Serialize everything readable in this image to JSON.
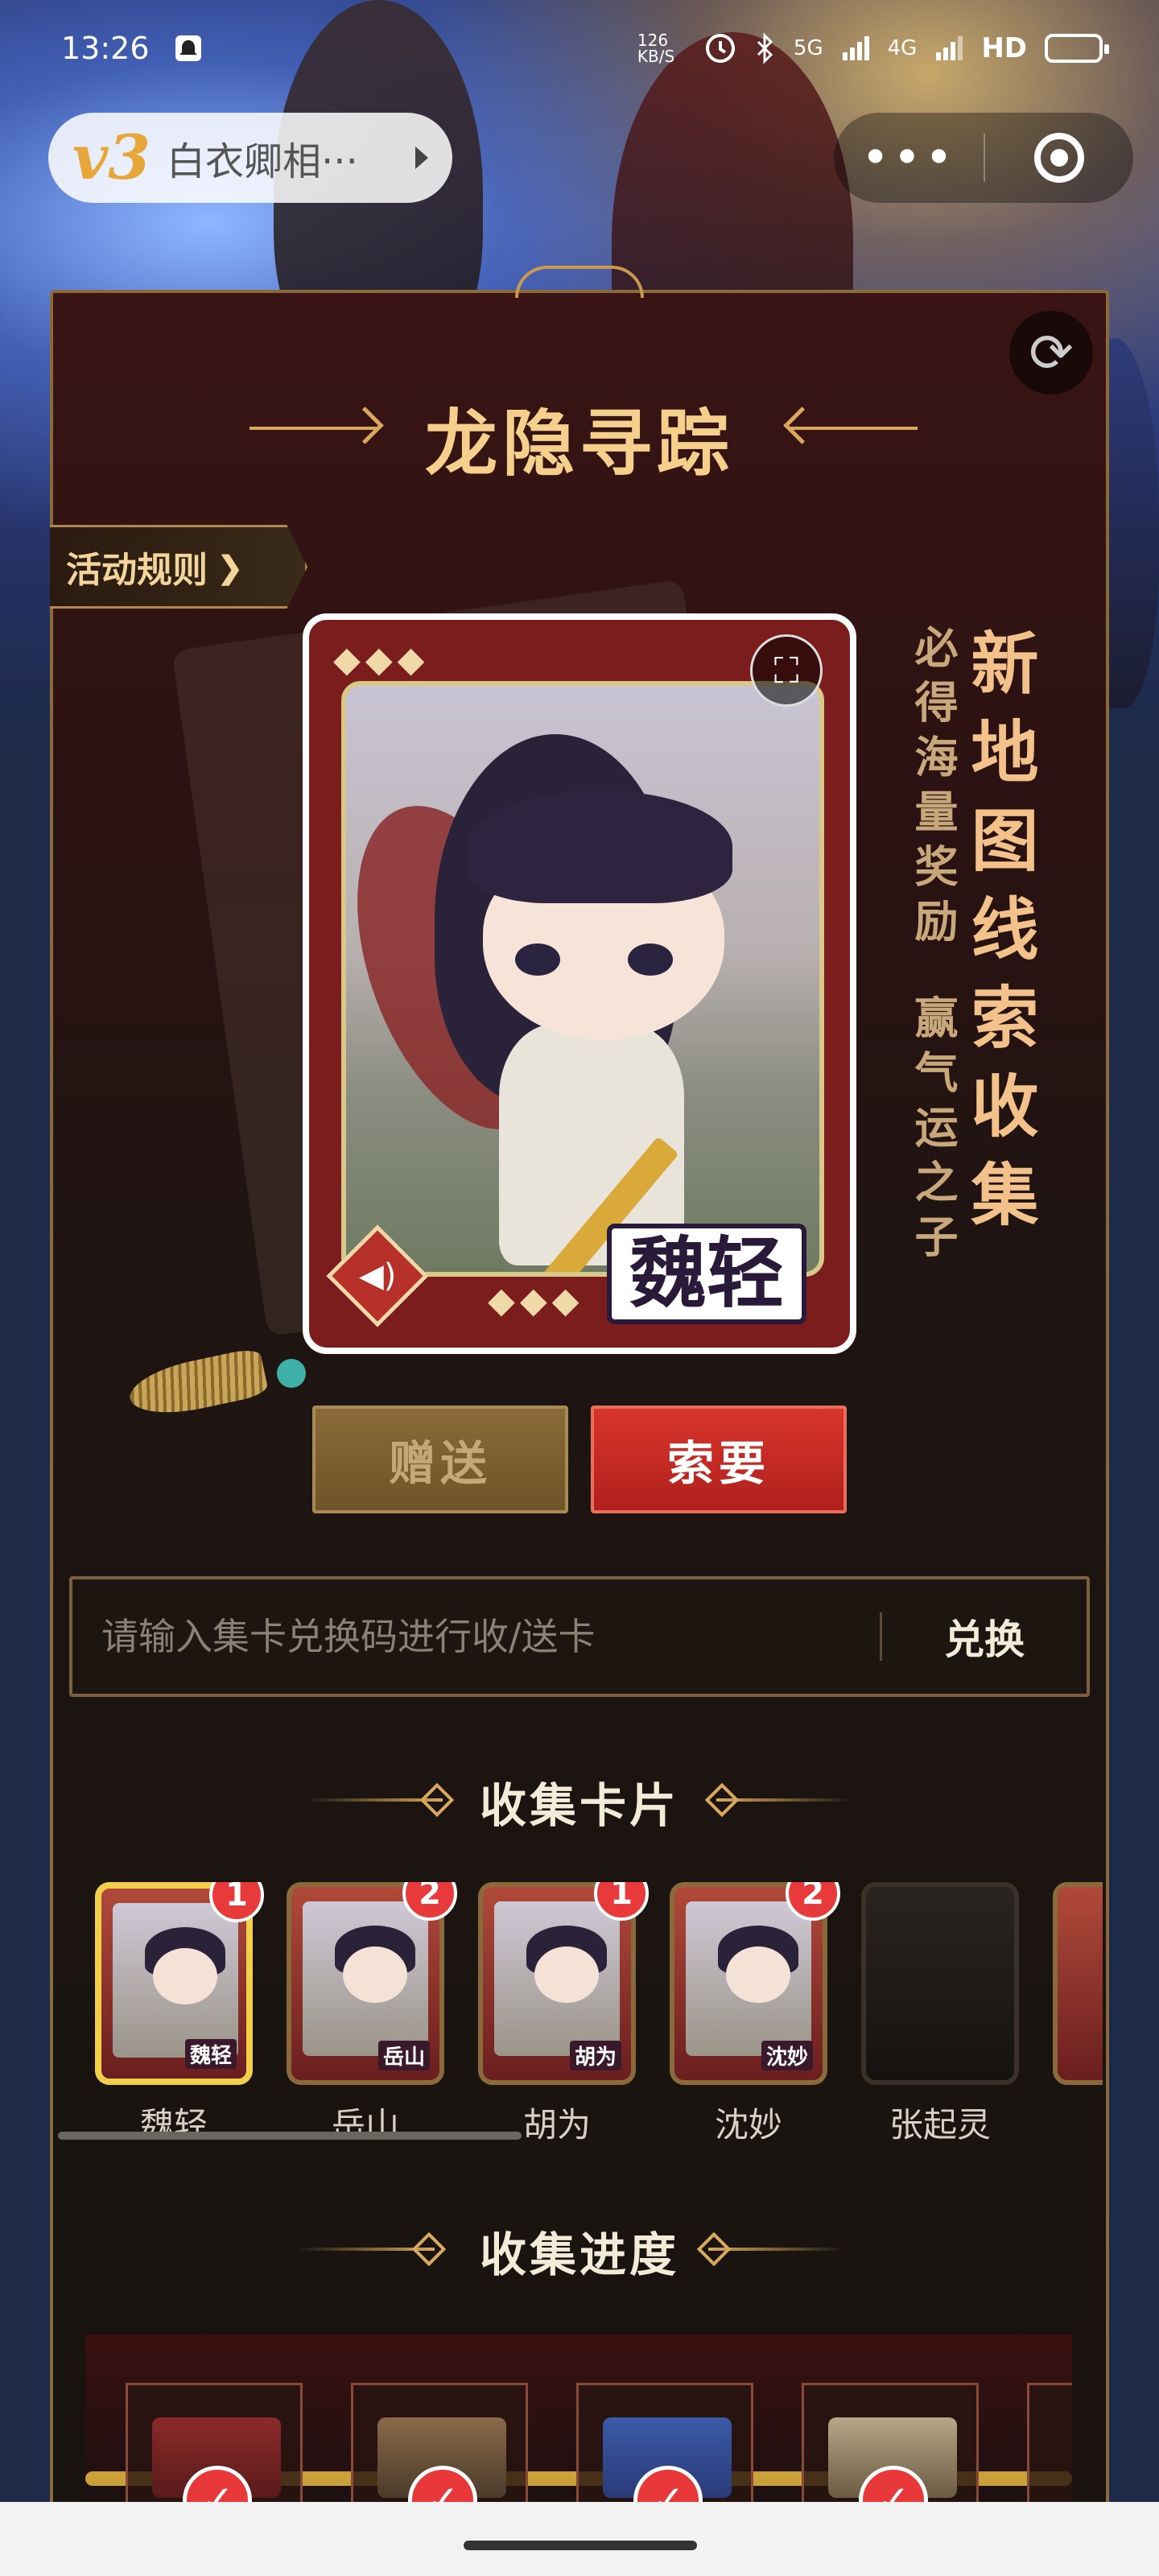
{
  "status_bar": {
    "time": "13:26",
    "net_speed": "126 KB/S",
    "signal_1": "5G",
    "signal_2": "4G",
    "hd": "HD"
  },
  "mini_program": {
    "logo": "v3",
    "title": "白衣卿相···",
    "more_label": "•••"
  },
  "activity": {
    "title": "龙隐寻踪",
    "rules_label": "活动规则"
  },
  "featured_card": {
    "name": "魏轻",
    "diamonds": "◆◆◆"
  },
  "slogans": {
    "main": "新地图线索收集",
    "line1": "必得海量奖励",
    "line2": "赢气运之子"
  },
  "actions": {
    "gift_label": "赠送",
    "ask_label": "索要"
  },
  "redeem": {
    "placeholder": "请输入集卡兑换码进行收/送卡",
    "button_label": "兑换"
  },
  "collect_section": {
    "title": "收集卡片",
    "cards": [
      {
        "name": "魏轻",
        "label": "魏轻",
        "count": "1",
        "active": true
      },
      {
        "name": "岳山",
        "label": "岳山",
        "count": "2",
        "active": false
      },
      {
        "name": "胡为",
        "label": "胡为",
        "count": "1",
        "active": false
      },
      {
        "name": "沈妙",
        "label": "沈妙",
        "count": "2",
        "active": false
      },
      {
        "name": "张起灵",
        "label": "",
        "count": "",
        "active": false,
        "locked": true
      }
    ]
  },
  "progress_section": {
    "title": "收集进度"
  },
  "colors": {
    "accent_gold": "#d8a85c",
    "button_red": "#d8352c",
    "badge_red": "#e83a3a"
  }
}
